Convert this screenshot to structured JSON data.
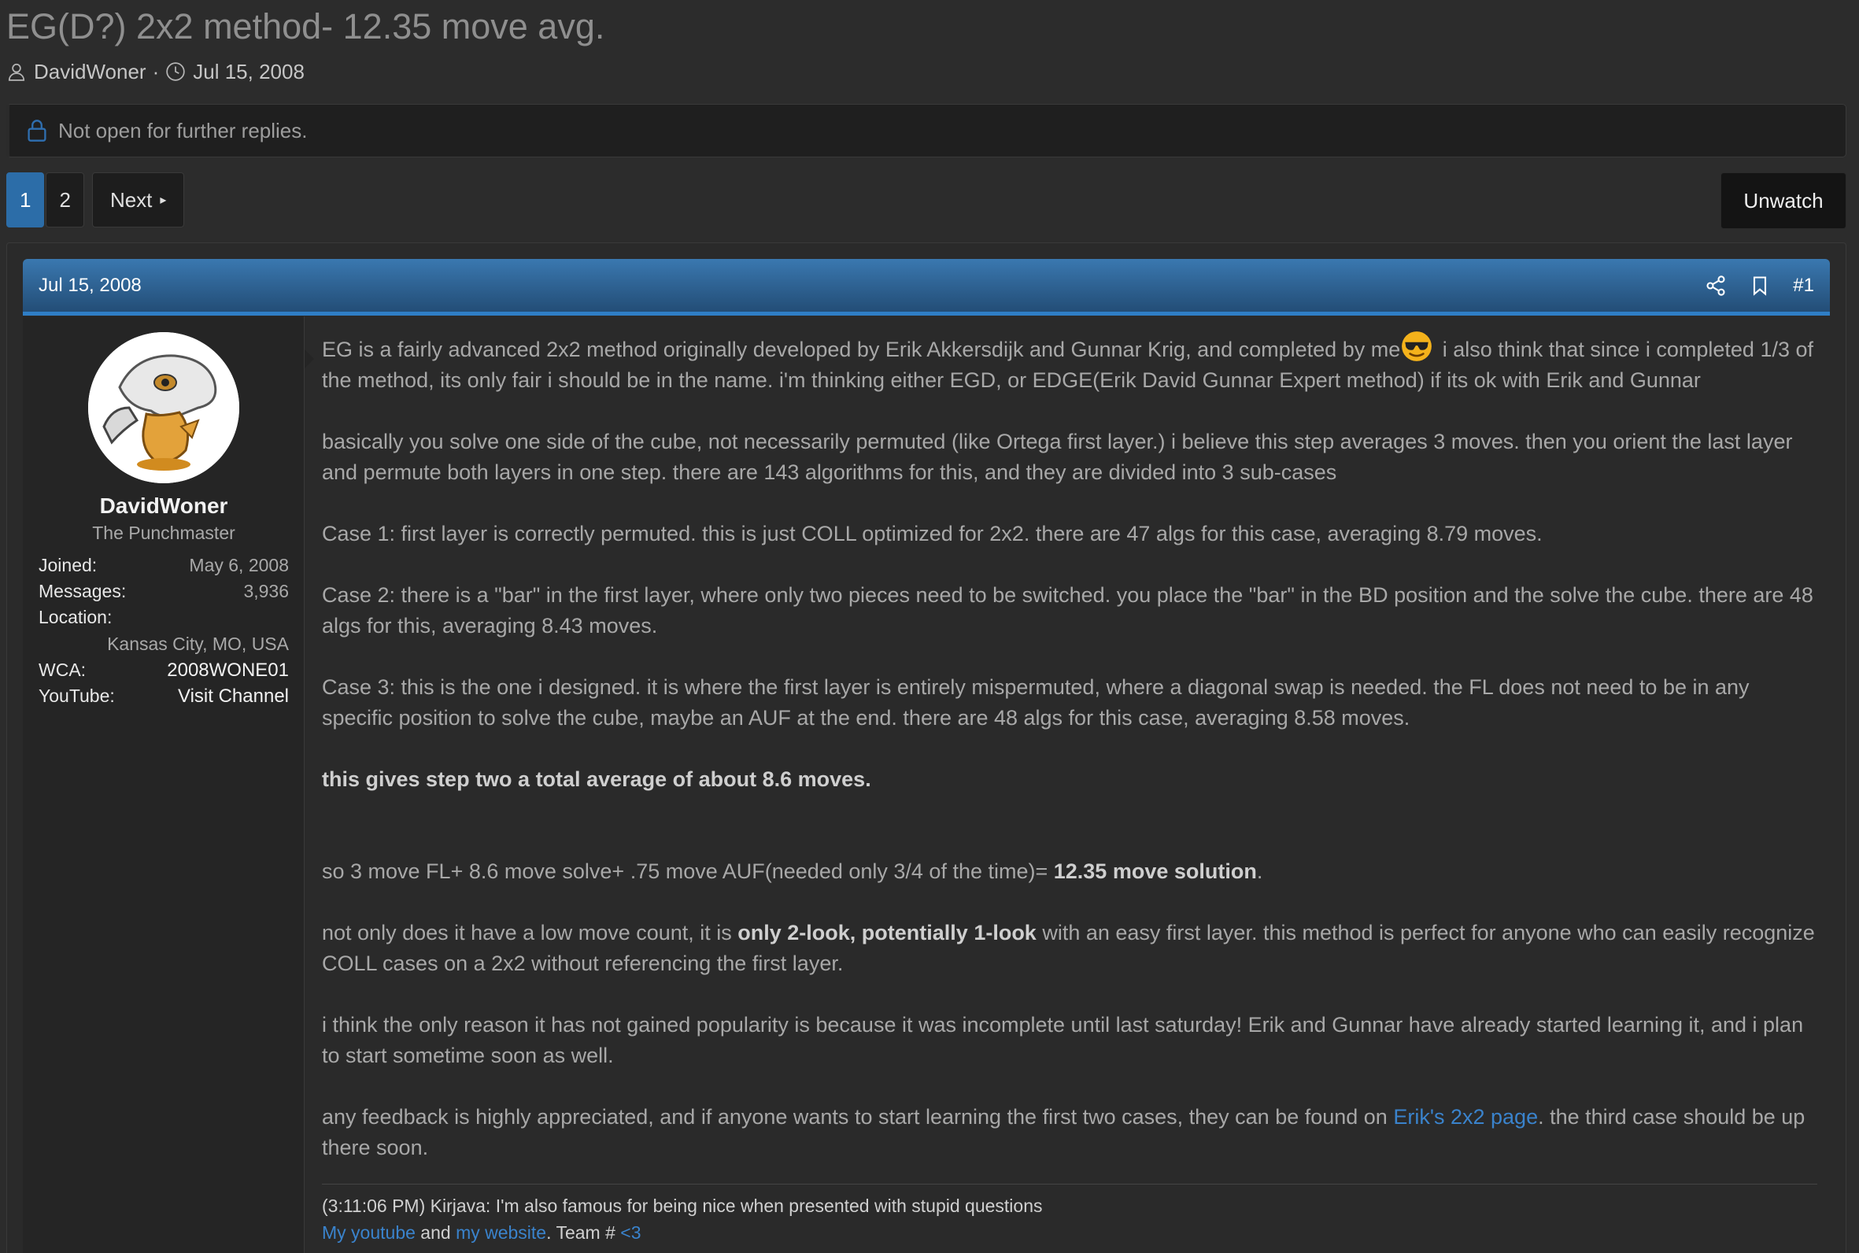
{
  "thread": {
    "title": "EG(D?) 2x2 method- 12.35 move avg.",
    "author": "DavidWoner",
    "date": "Jul 15, 2008",
    "meta_separator": "·"
  },
  "notice": {
    "text": "Not open for further replies."
  },
  "pagination": {
    "pages": [
      "1",
      "2"
    ],
    "current": "1",
    "next_label": "Next"
  },
  "actions": {
    "unwatch_label": "Unwatch"
  },
  "post": {
    "date": "Jul 15, 2008",
    "number": "#1",
    "user": {
      "name": "DavidWoner",
      "title": "The Punchmaster",
      "stats": [
        {
          "label": "Joined:",
          "value": "May 6, 2008"
        },
        {
          "label": "Messages:",
          "value": "3,936"
        },
        {
          "label": "Location:",
          "value": "Kansas City, MO, USA"
        },
        {
          "label": "WCA:",
          "value": "2008WONE01"
        },
        {
          "label": "YouTube:",
          "value": "Visit Channel"
        }
      ]
    },
    "body": {
      "p1_a": "EG is a fairly advanced 2x2 method originally developed by Erik Akkersdijk and Gunnar Krig, and completed by me",
      "p1_b": " i also think that since i completed 1/3 of the method, its only fair i should be in the name. i'm thinking either EGD, or EDGE(Erik David Gunnar Expert method) if its ok with Erik and Gunnar",
      "p2": "basically you solve one side of the cube, not necessarily permuted (like Ortega first layer.) i believe this step averages 3 moves. then you orient the last layer and permute both layers in one step. there are 143 algorithms for this, and they are divided into 3 sub-cases",
      "p3": "Case 1: first layer is correctly permuted. this is just COLL optimized for 2x2. there are 47 algs for this case, averaging 8.79 moves.",
      "p4": "Case 2: there is a \"bar\" in the first layer, where only two pieces need to be switched. you place the \"bar\" in the BD position and the solve the cube. there are 48 algs for this, averaging 8.43 moves.",
      "p5": "Case 3: this is the one i designed. it is where the first layer is entirely mispermuted, where a diagonal swap is needed. the FL does not need to be in any specific position to solve the cube, maybe an AUF at the end. there are 48 algs for this case, averaging 8.58 moves.",
      "p6": "this gives step two a total average of about 8.6 moves.",
      "p7_a": "so 3 move FL+ 8.6 move solve+ .75 move AUF(needed only 3/4 of the time)= ",
      "p7_b": "12.35 move solution",
      "p7_c": ".",
      "p8_a": "not only does it have a low move count, it is ",
      "p8_b": "only 2-look, potentially 1-look",
      "p8_c": " with an easy first layer. this method is perfect for anyone who can easily recognize COLL cases on a 2x2 without referencing the first layer.",
      "p9": "i think the only reason it has not gained popularity is because it was incomplete until last saturday! Erik and Gunnar have already started learning it, and i plan to start sometime soon as well.",
      "p10_a": "any feedback is highly appreciated, and if anyone wants to start learning the first two cases, they can be found on ",
      "p10_link": "Erik's 2x2 page",
      "p10_b": ". the third case should be up there soon."
    },
    "signature": {
      "line1": "(3:11:06 PM) Kirjava: I'm also famous for being nice when presented with stupid questions",
      "link1": "My youtube",
      "and": " and ",
      "link2": "my website",
      "mid": ". Team # ",
      "link3": "<3"
    }
  },
  "colors": {
    "accent": "#2c6da8",
    "link": "#3a83cc",
    "background": "#2c2c2c"
  },
  "icons": [
    "user-icon",
    "clock-icon",
    "lock-icon",
    "share-icon",
    "bookmark-icon",
    "cool-emoji-icon",
    "next-arrow-icon"
  ]
}
